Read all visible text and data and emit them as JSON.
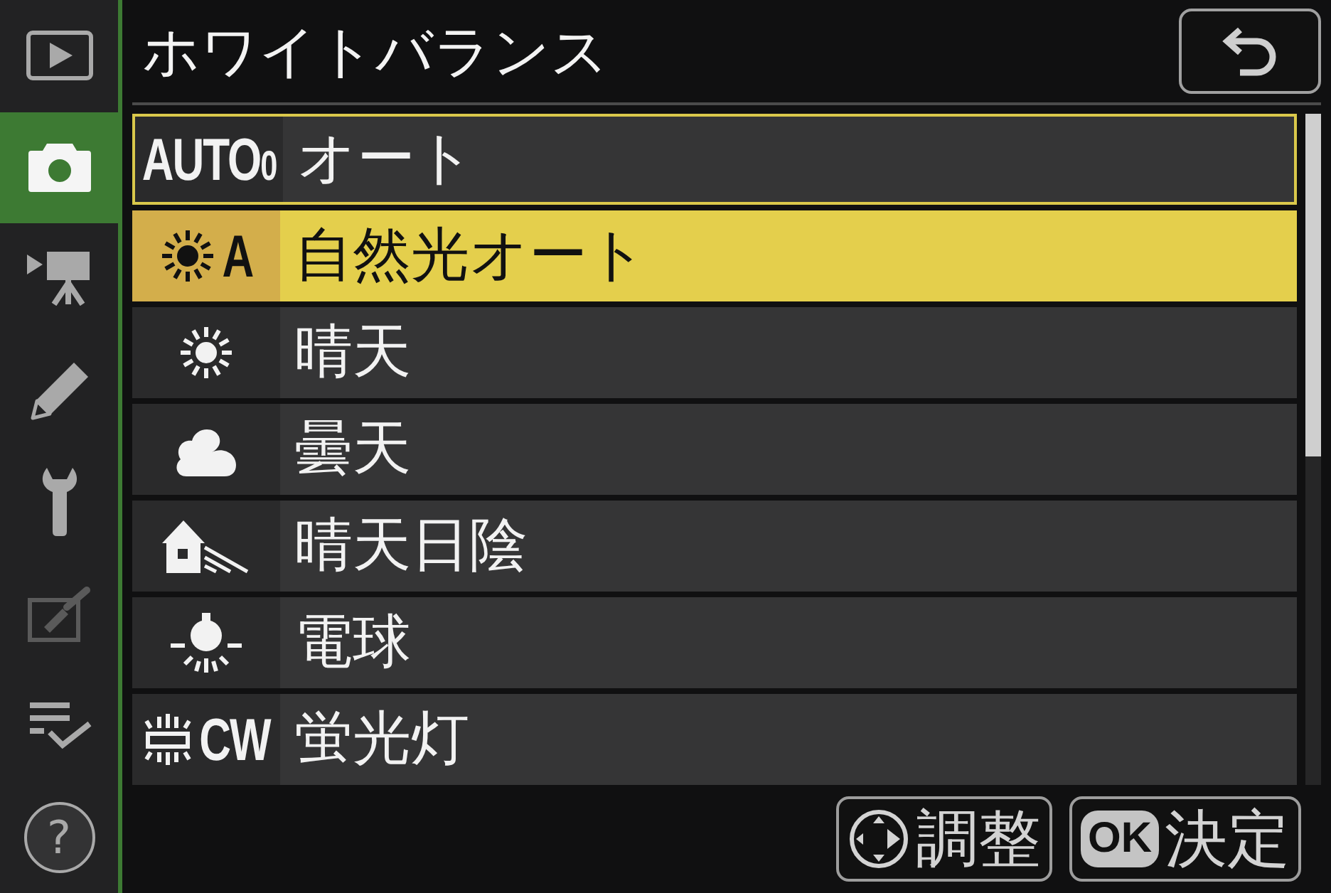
{
  "sidebar": {
    "items": [
      {
        "kind": "playback",
        "selected": false,
        "disabled": false
      },
      {
        "kind": "photo_shooting",
        "selected": true,
        "disabled": false
      },
      {
        "kind": "movie_shooting",
        "selected": false,
        "disabled": false
      },
      {
        "kind": "custom_settings",
        "selected": false,
        "disabled": false
      },
      {
        "kind": "setup",
        "selected": false,
        "disabled": false
      },
      {
        "kind": "retouch",
        "selected": false,
        "disabled": true
      },
      {
        "kind": "my_menu",
        "selected": false,
        "disabled": false
      },
      {
        "kind": "help",
        "glyph": "?",
        "selected": false,
        "disabled": false
      }
    ]
  },
  "header": {
    "title": "ホワイトバランス"
  },
  "list": {
    "rows": [
      {
        "kind": "auto",
        "symbol": "AUTO$_{0}$",
        "label": "オート",
        "selected": false,
        "current": true
      },
      {
        "kind": "natural_auto",
        "symbol": "A",
        "label": "自然光オート",
        "selected": true,
        "current": false
      },
      {
        "kind": "sunny",
        "label": "晴天",
        "selected": false,
        "current": false
      },
      {
        "kind": "cloudy",
        "label": "曇天",
        "selected": false,
        "current": false
      },
      {
        "kind": "shade",
        "label": "晴天日陰",
        "selected": false,
        "current": false
      },
      {
        "kind": "incandescent",
        "label": "電球",
        "selected": false,
        "current": false
      },
      {
        "kind": "fluorescent",
        "symbol": "CW",
        "label": "蛍光灯",
        "selected": false,
        "current": false
      }
    ]
  },
  "footer": {
    "buttons": [
      {
        "kind": "dpad",
        "label": "調整"
      },
      {
        "kind": "ok",
        "key": "OK",
        "label": "決定"
      }
    ]
  }
}
